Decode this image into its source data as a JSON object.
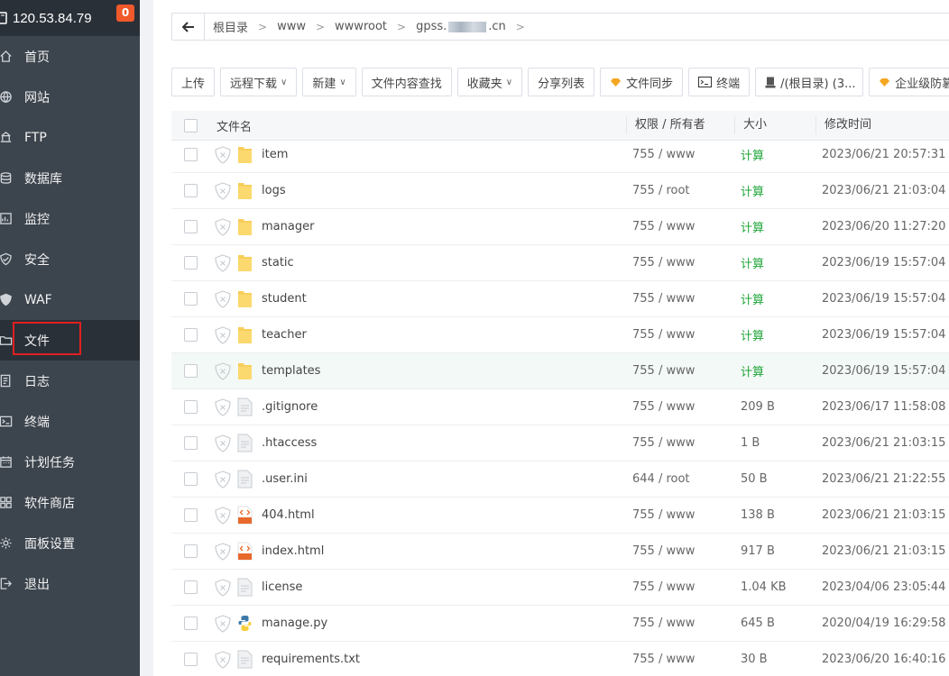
{
  "sidebar": {
    "host": "120.53.84.79",
    "badge": "0",
    "items": [
      {
        "label": "首页",
        "icon": "home-icon"
      },
      {
        "label": "网站",
        "icon": "globe-icon"
      },
      {
        "label": "FTP",
        "icon": "ftp-icon"
      },
      {
        "label": "数据库",
        "icon": "database-icon"
      },
      {
        "label": "监控",
        "icon": "monitor-icon"
      },
      {
        "label": "安全",
        "icon": "shield-icon"
      },
      {
        "label": "WAF",
        "icon": "waf-shield-icon"
      },
      {
        "label": "文件",
        "icon": "folder-icon"
      },
      {
        "label": "日志",
        "icon": "log-icon"
      },
      {
        "label": "终端",
        "icon": "terminal-icon"
      },
      {
        "label": "计划任务",
        "icon": "calendar-icon"
      },
      {
        "label": "软件商店",
        "icon": "apps-icon"
      },
      {
        "label": "面板设置",
        "icon": "gear-icon"
      },
      {
        "label": "退出",
        "icon": "logout-icon"
      }
    ],
    "active_index": 7
  },
  "breadcrumb": {
    "items": [
      "根目录",
      "www",
      "wwwroot"
    ],
    "last_prefix": "gpss.",
    "last_suffix": ".cn"
  },
  "toolbar": {
    "upload": "上传",
    "remote_download": "远程下载",
    "new": "新建",
    "content_search": "文件内容查找",
    "favorites": "收藏夹",
    "share_list": "分享列表",
    "file_sync": "文件同步",
    "terminal": "终端",
    "disk": "/(根目录) (3...",
    "enterprise": "企业级防篡改"
  },
  "table": {
    "headers": {
      "name": "文件名",
      "perm": "权限 / 所有者",
      "size": "大小",
      "time": "修改时间"
    },
    "rows": [
      {
        "name": "item",
        "type": "folder",
        "perm": "755 / www",
        "size": "计算",
        "time": "2023/06/21 20:57:31"
      },
      {
        "name": "logs",
        "type": "folder",
        "perm": "755 / root",
        "size": "计算",
        "time": "2023/06/21 21:03:04"
      },
      {
        "name": "manager",
        "type": "folder",
        "perm": "755 / www",
        "size": "计算",
        "time": "2023/06/20 11:27:20"
      },
      {
        "name": "static",
        "type": "folder",
        "perm": "755 / www",
        "size": "计算",
        "time": "2023/06/19 15:57:04"
      },
      {
        "name": "student",
        "type": "folder",
        "perm": "755 / www",
        "size": "计算",
        "time": "2023/06/19 15:57:04"
      },
      {
        "name": "teacher",
        "type": "folder",
        "perm": "755 / www",
        "size": "计算",
        "time": "2023/06/19 15:57:04"
      },
      {
        "name": "templates",
        "type": "folder",
        "perm": "755 / www",
        "size": "计算",
        "time": "2023/06/19 15:57:04"
      },
      {
        "name": ".gitignore",
        "type": "file",
        "perm": "755 / www",
        "size": "209 B",
        "time": "2023/06/17 11:58:08"
      },
      {
        "name": ".htaccess",
        "type": "file",
        "perm": "755 / www",
        "size": "1 B",
        "time": "2023/06/21 21:03:15"
      },
      {
        "name": ".user.ini",
        "type": "file",
        "perm": "644 / root",
        "size": "50 B",
        "time": "2023/06/21 21:22:55"
      },
      {
        "name": "404.html",
        "type": "html",
        "perm": "755 / www",
        "size": "138 B",
        "time": "2023/06/21 21:03:15"
      },
      {
        "name": "index.html",
        "type": "html",
        "perm": "755 / www",
        "size": "917 B",
        "time": "2023/06/21 21:03:15"
      },
      {
        "name": "license",
        "type": "file",
        "perm": "755 / www",
        "size": "1.04 KB",
        "time": "2023/04/06 23:05:44"
      },
      {
        "name": "manage.py",
        "type": "python",
        "perm": "755 / www",
        "size": "645 B",
        "time": "2020/04/19 16:29:58"
      },
      {
        "name": "requirements.txt",
        "type": "file",
        "perm": "755 / www",
        "size": "30 B",
        "time": "2023/06/20 16:40:16"
      }
    ],
    "hover_index": 6
  },
  "colors": {
    "sidebar": "#3c444d",
    "accent_green": "#20a53a",
    "badge": "#f0592a",
    "highlight": "#e02020"
  }
}
